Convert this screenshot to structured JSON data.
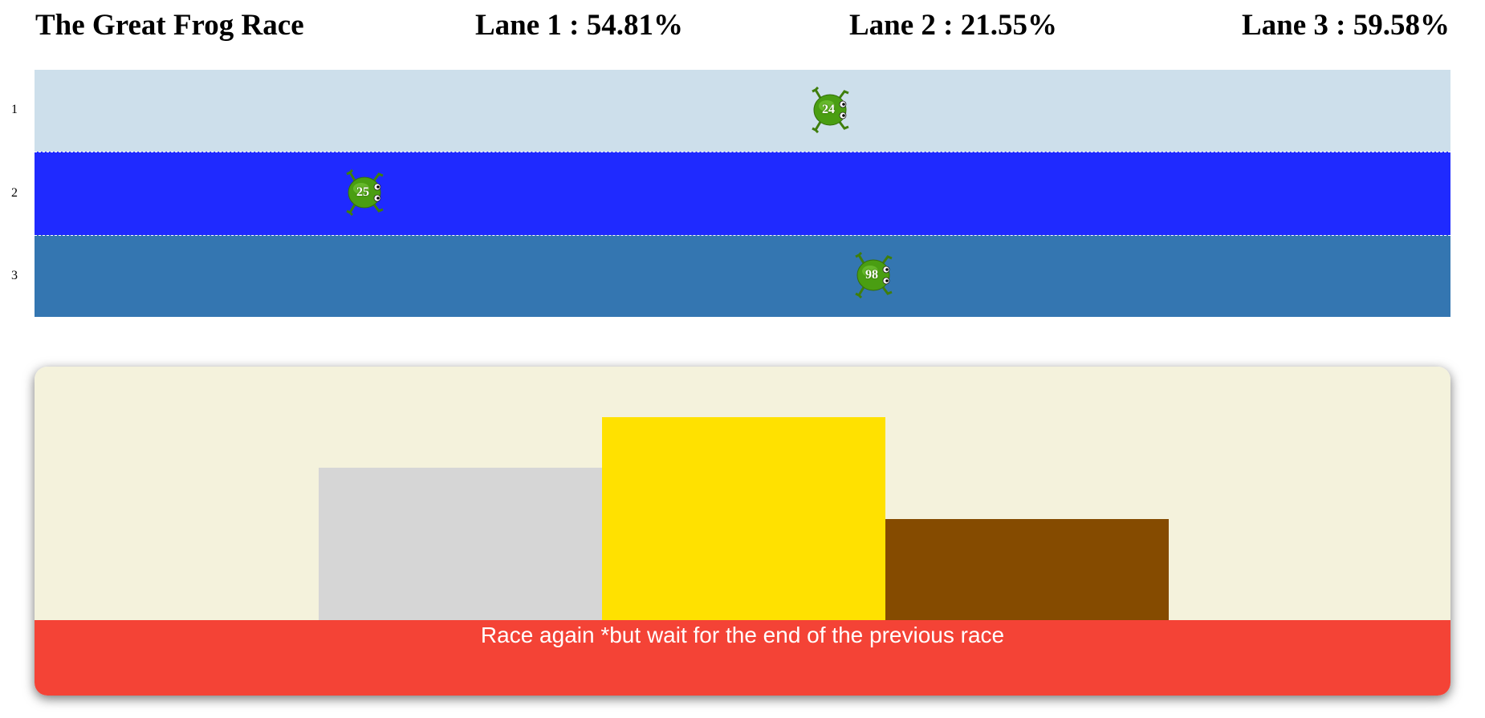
{
  "header": {
    "title": "The Great Frog Race",
    "lane_stats": [
      "Lane 1 : 54.81%",
      "Lane 2 : 21.55%",
      "Lane 3 : 59.58%"
    ]
  },
  "lanes": [
    {
      "number": "1",
      "color": "#cddfeb",
      "frog_label": "24",
      "progress_percent": 54.81
    },
    {
      "number": "2",
      "color": "#1f2aff",
      "frog_label": "25",
      "progress_percent": 21.55
    },
    {
      "number": "3",
      "color": "#3476b1",
      "frog_label": "98",
      "progress_percent": 59.58
    }
  ],
  "podium": {
    "background": "#f4f2dc",
    "places": [
      {
        "place": "second",
        "color": "#d6d6d6"
      },
      {
        "place": "first",
        "color": "#ffe100"
      },
      {
        "place": "third",
        "color": "#854b00"
      }
    ]
  },
  "race_button": {
    "label": "Race again *but wait for the end of the previous race",
    "color": "#f44336"
  },
  "frog": {
    "icon": "frog-icon",
    "body_color": "#4a9e12"
  }
}
